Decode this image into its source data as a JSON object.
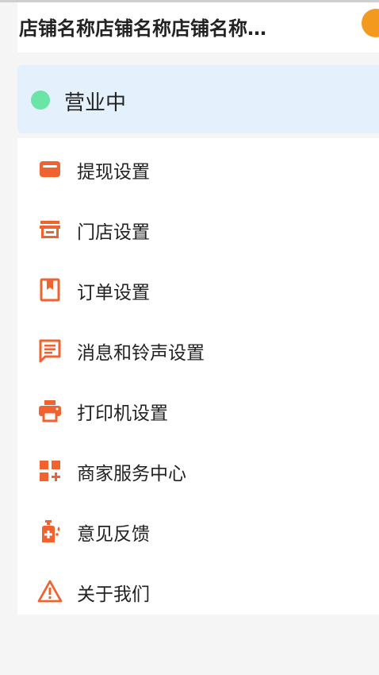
{
  "header": {
    "shop_name": "店铺名称店铺名称店铺名称…",
    "avatar_icon": "avatar-icon",
    "avatar_color": "#f39a1e"
  },
  "status": {
    "label": "营业中",
    "dot_color": "#69e6a6",
    "background": "#e4f1fc"
  },
  "accent_color": "#f0622e",
  "menu": {
    "items": [
      {
        "label": "提现设置",
        "icon": "wallet-icon"
      },
      {
        "label": "门店设置",
        "icon": "store-icon"
      },
      {
        "label": "订单设置",
        "icon": "bookmark-icon"
      },
      {
        "label": "消息和铃声设置",
        "icon": "message-icon"
      },
      {
        "label": "打印机设置",
        "icon": "printer-icon"
      },
      {
        "label": "商家服务中心",
        "icon": "apps-add-icon"
      },
      {
        "label": "意见反馈",
        "icon": "feedback-bottle-icon"
      },
      {
        "label": "关于我们",
        "icon": "warning-triangle-icon"
      }
    ]
  }
}
